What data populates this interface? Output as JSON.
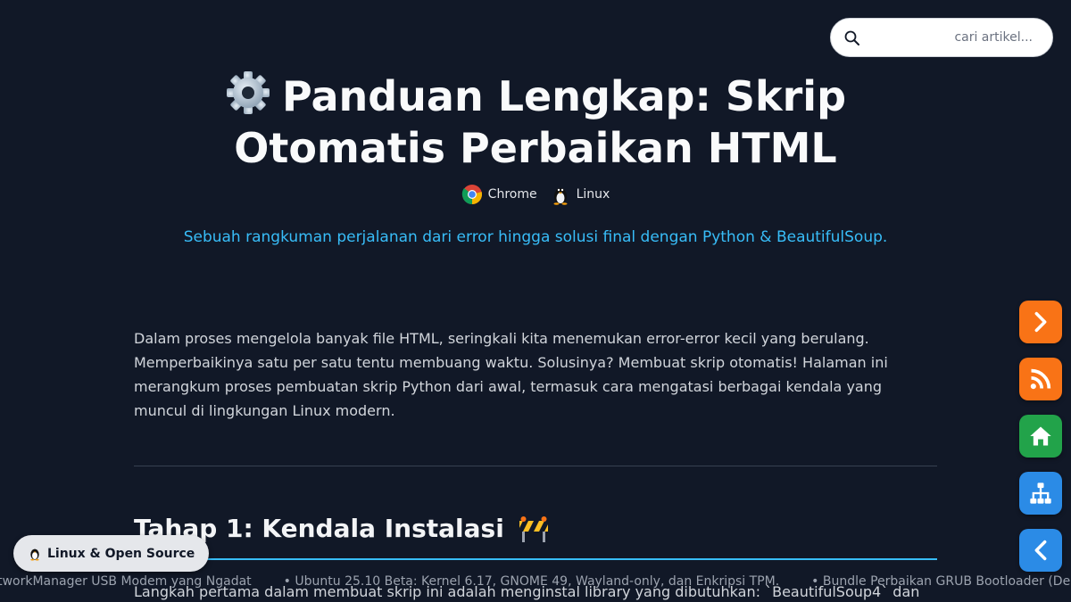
{
  "search": {
    "placeholder": "cari artikel..."
  },
  "article": {
    "title_line1": "Panduan Lengkap: Skrip",
    "title_line2": "Otomatis Perbaikan HTML",
    "tags": [
      "Chrome",
      "Linux"
    ],
    "subtitle": "Sebuah rangkuman perjalanan dari error hingga solusi final dengan Python & BeautifulSoup.",
    "intro": "Dalam proses mengelola banyak file HTML, seringkali kita menemukan error-error kecil yang berulang. Memperbaikinya satu per satu tentu membuang waktu. Solusinya? Membuat skrip otomatis! Halaman ini merangkum proses pembuatan skrip Python dari awal, termasuk cara mengatasi berbagai kendala yang muncul di lingkungan Linux modern.",
    "section1_heading": "Tahap 1: Kendala Instalasi",
    "section1_text": "Langkah pertama dalam membuat skrip ini adalah menginstal library yang dibutuhkan: `BeautifulSoup4` dan"
  },
  "ticker": [
    "NetworkManager USB Modem yang Ngadat",
    "• Ubuntu 25.10 Beta: Kernel 6.17, GNOME 49, Wayland-only, dan Enkripsi TPM.",
    "• Bundle Perbaikan GRUB Bootloader (Debian"
  ],
  "badge": {
    "label": "Linux & Open Source"
  },
  "fab_colors": {
    "next": "#f97316",
    "rss": "#f97316",
    "home": "#22a34a",
    "sitemap": "#2b8be6",
    "back": "#2b8be6"
  }
}
